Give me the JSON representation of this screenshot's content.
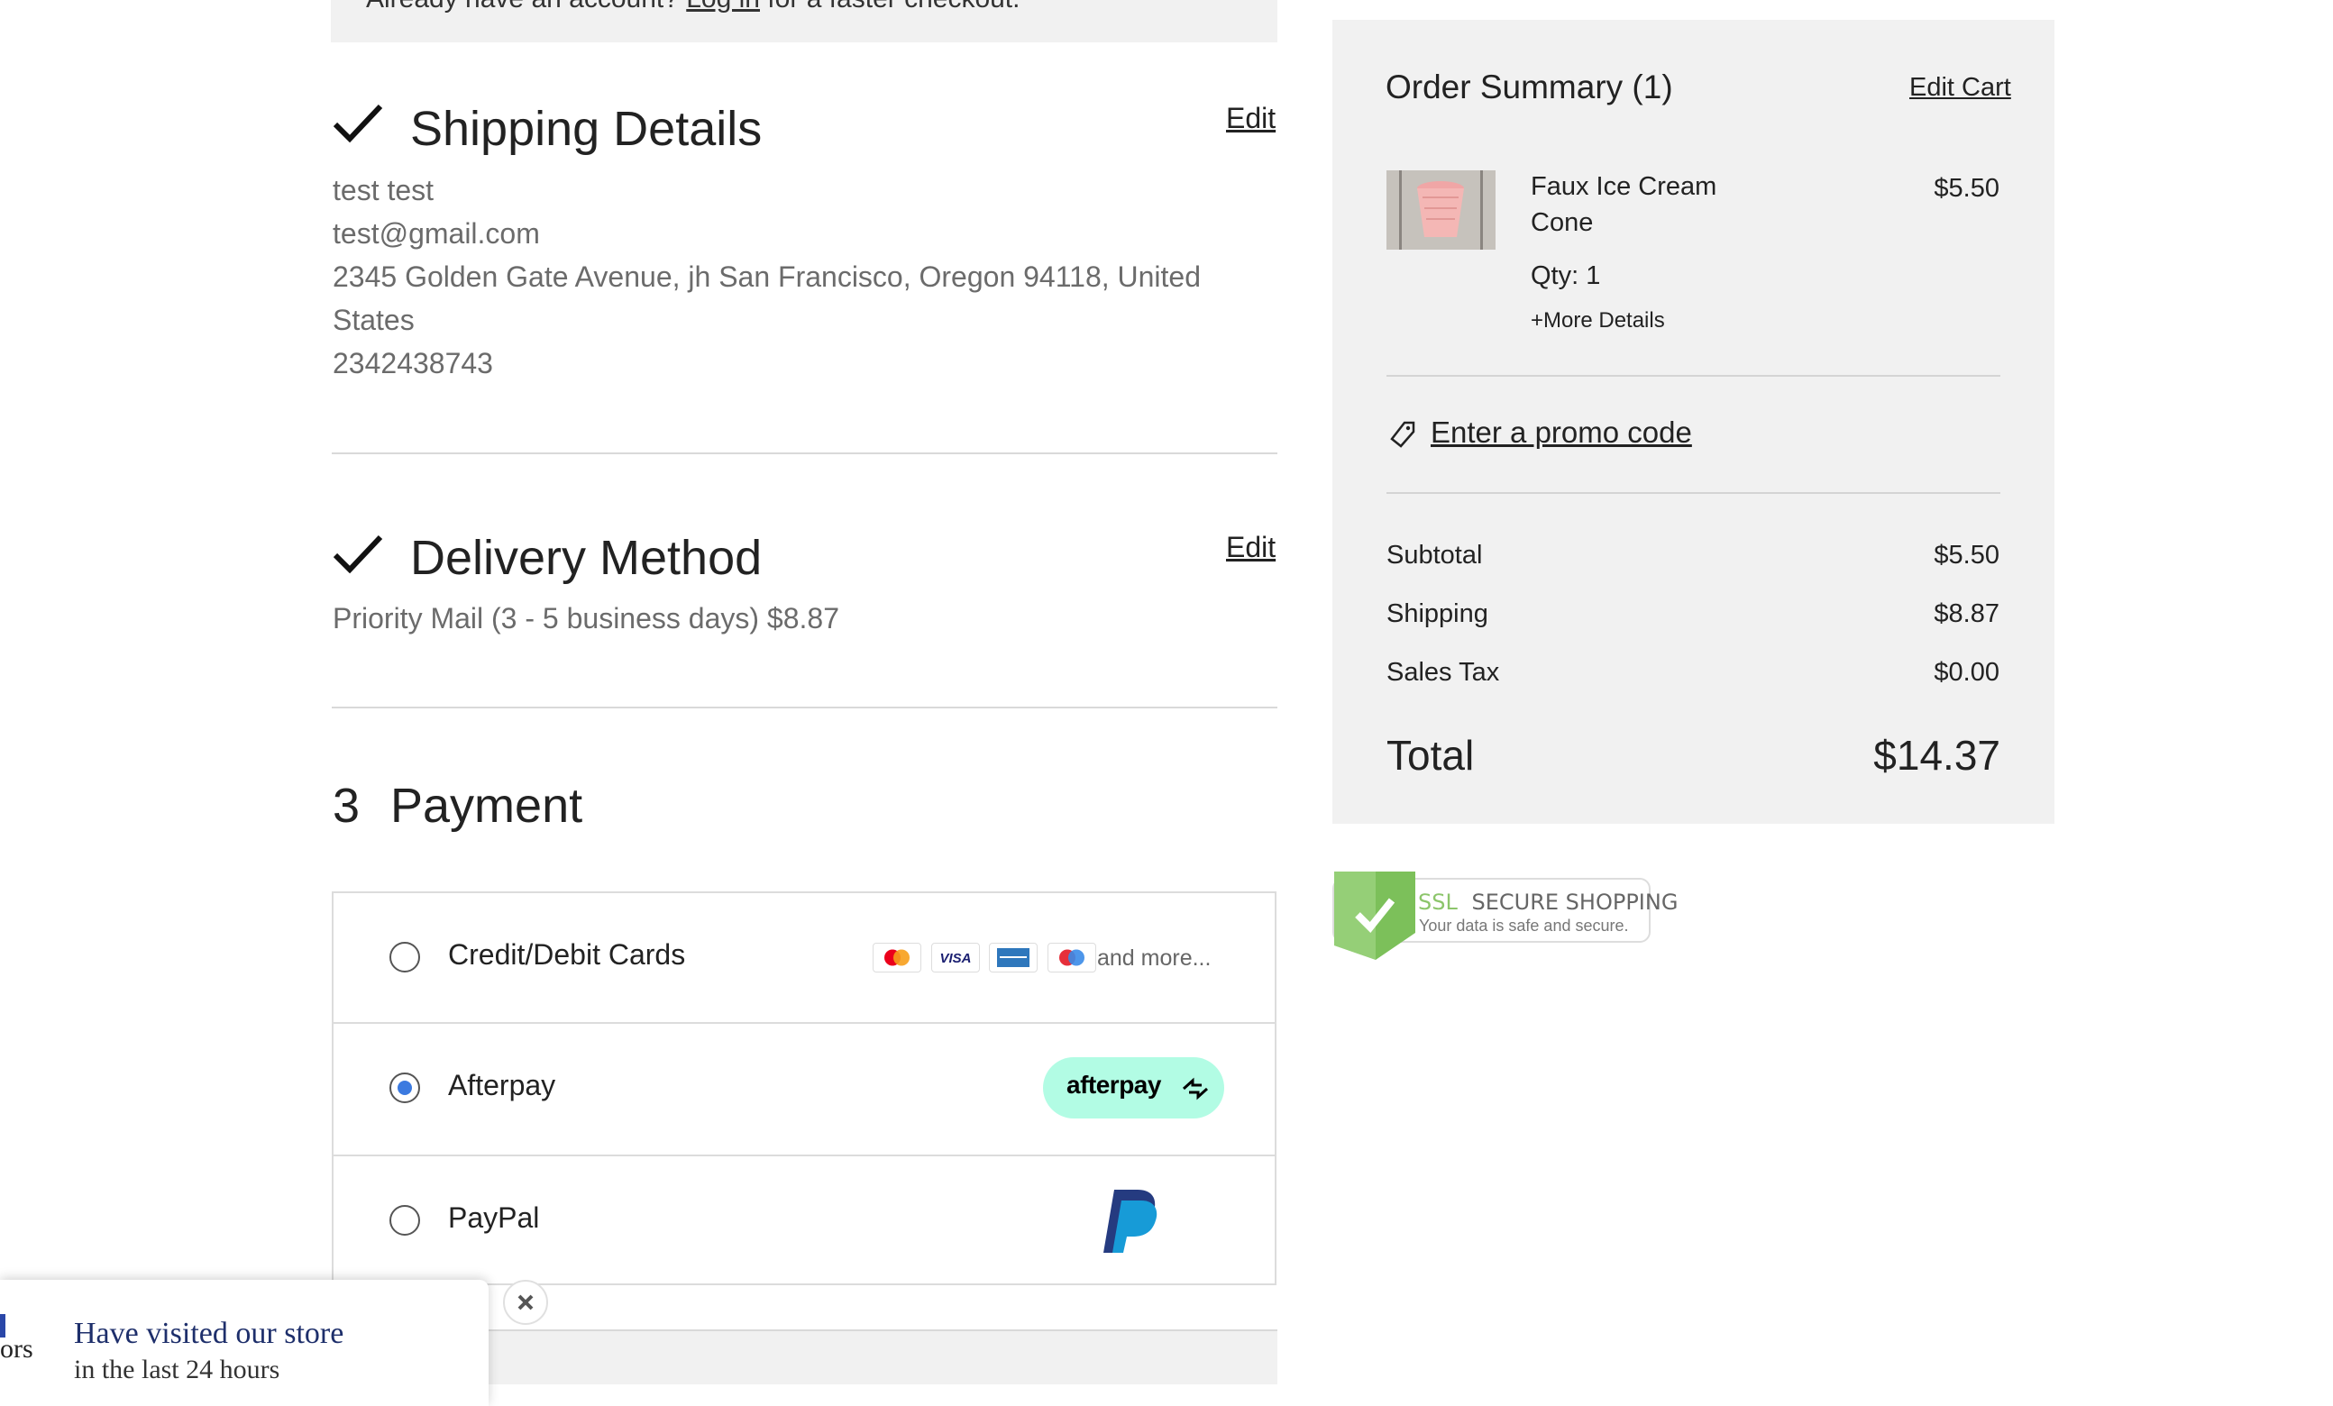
{
  "login_banner": {
    "prefix": "Already have an account?",
    "link": "Log in",
    "suffix": "for a faster checkout."
  },
  "shipping": {
    "title": "Shipping Details",
    "edit": "Edit",
    "name": "test test",
    "email": "test@gmail.com",
    "address_line1": "2345 Golden Gate Avenue, jh San Francisco, Oregon 94118, United",
    "address_line2": "States",
    "phone": "2342438743"
  },
  "delivery": {
    "title": "Delivery Method",
    "edit": "Edit",
    "method": "Priority Mail (3 - 5 business days) $8.87"
  },
  "payment": {
    "step": "3",
    "title": "Payment",
    "options": [
      {
        "label": "Credit/Debit Cards",
        "selected": false,
        "extra": "and more..."
      },
      {
        "label": "Afterpay",
        "selected": true,
        "badge": "afterpay"
      },
      {
        "label": "PayPal",
        "selected": false
      }
    ]
  },
  "summary": {
    "title": "Order Summary (1)",
    "edit_cart": "Edit Cart",
    "item": {
      "name_line1": "Faux Ice Cream",
      "name_line2": "Cone",
      "price": "$5.50",
      "qty": "Qty: 1",
      "more": "+More Details"
    },
    "promo": "Enter a promo code",
    "rows": [
      {
        "label": "Subtotal",
        "value": "$5.50"
      },
      {
        "label": "Shipping",
        "value": "$8.87"
      },
      {
        "label": "Sales Tax",
        "value": "$0.00"
      }
    ],
    "total_label": "Total",
    "total_value": "$14.37"
  },
  "ssl": {
    "ssl": "SSL",
    "title": "SECURE SHOPPING",
    "subtitle": "Your data is safe and secure."
  },
  "popup": {
    "line1": "Have visited our store",
    "line2": "in the last 24 hours",
    "side_text": "ors"
  },
  "colors": {
    "accent_radio": "#3b7ae0",
    "afterpay": "#b2fce4",
    "panel": "#f1f1f1",
    "ssl_green": "#7cc05a"
  }
}
